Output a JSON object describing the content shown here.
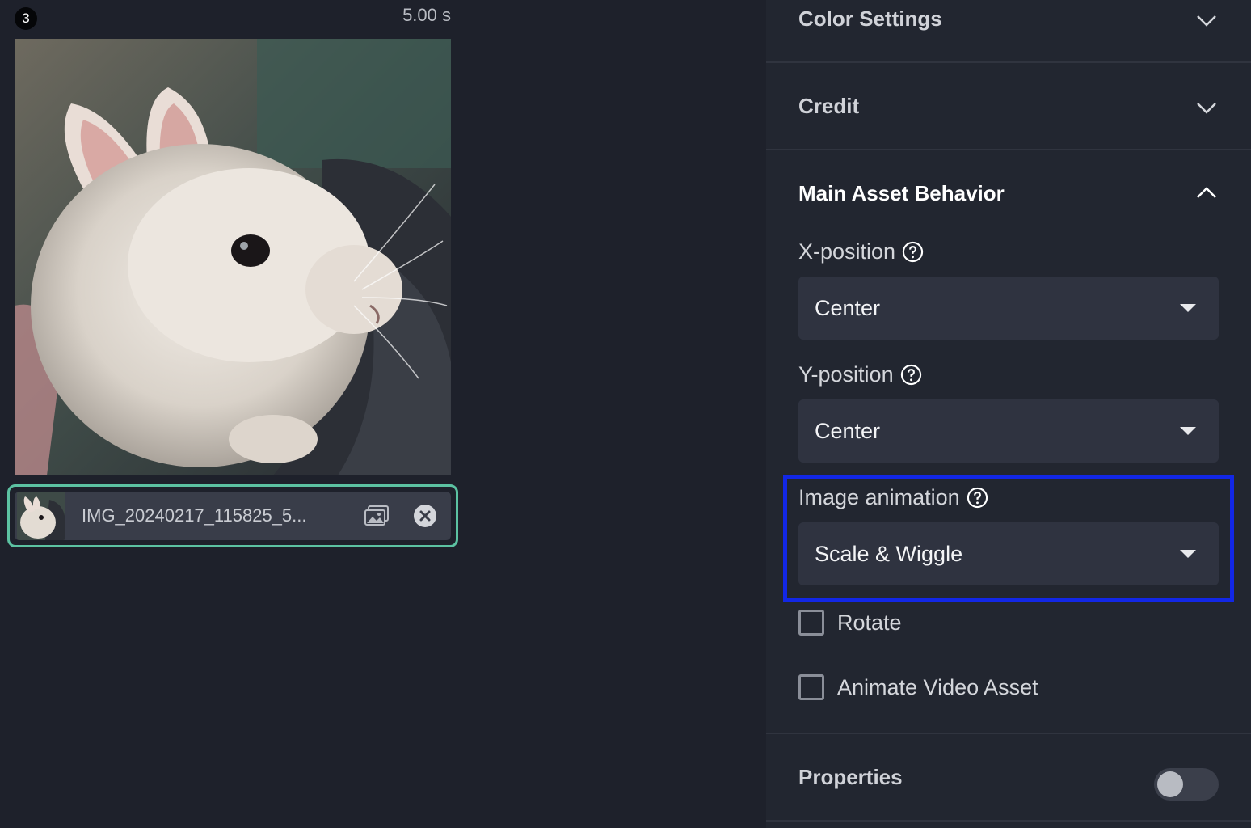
{
  "scene": {
    "number": "3",
    "duration": "5.00 s"
  },
  "asset": {
    "filename": "IMG_20240217_115825_5...",
    "replace_icon": "image-gallery-icon",
    "remove_icon": "close-circle-icon"
  },
  "sections": {
    "color_settings": {
      "title": "Color Settings",
      "state": "collapsed"
    },
    "credit": {
      "title": "Credit",
      "state": "collapsed"
    },
    "main_asset_behavior": {
      "title": "Main Asset Behavior",
      "state": "expanded",
      "x_position": {
        "label": "X-position",
        "value": "Center"
      },
      "y_position": {
        "label": "Y-position",
        "value": "Center"
      },
      "image_animation": {
        "label": "Image animation",
        "value": "Scale & Wiggle"
      },
      "rotate": {
        "label": "Rotate",
        "checked": false
      },
      "animate_video_asset": {
        "label": "Animate Video Asset",
        "checked": false
      }
    },
    "properties": {
      "title": "Properties",
      "toggle_on": false
    }
  },
  "colors": {
    "accent_chip_border": "#5cc2a2",
    "highlight_border": "#1227e6",
    "panel_bg": "#222630",
    "canvas_bg": "#1e212b"
  }
}
